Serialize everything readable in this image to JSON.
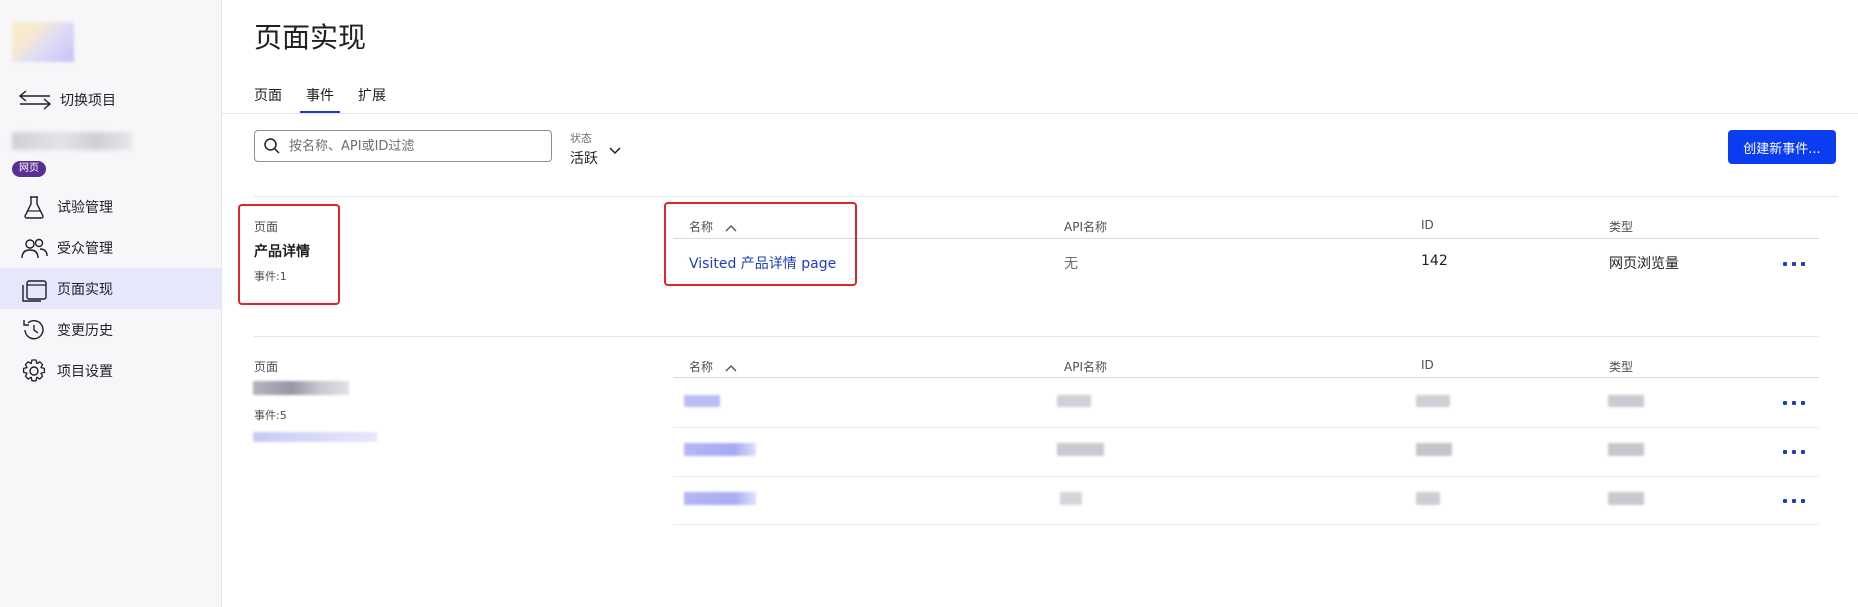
{
  "sidebar": {
    "switch_project": "切换项目",
    "badge": "网页",
    "items": [
      {
        "label": "试验管理",
        "icon": "flask-icon"
      },
      {
        "label": "受众管理",
        "icon": "audience-icon"
      },
      {
        "label": "页面实现",
        "icon": "pages-icon",
        "active": true
      },
      {
        "label": "变更历史",
        "icon": "history-icon"
      },
      {
        "label": "项目设置",
        "icon": "gear-icon"
      }
    ]
  },
  "header": {
    "title": "页面实现",
    "tabs": [
      "页面",
      "事件",
      "扩展"
    ],
    "active_tab": "事件"
  },
  "toolbar": {
    "search_placeholder": "按名称、API或ID过滤",
    "status_label": "状态",
    "status_value": "活跃",
    "create_button": "创建新事件..."
  },
  "columns": {
    "name": "名称",
    "api_name": "API名称",
    "id": "ID",
    "type": "类型"
  },
  "groups": [
    {
      "page_label": "页面",
      "page_name": "产品详情",
      "event_count": "事件:1",
      "rows": [
        {
          "name": "Visited 产品详情 page",
          "api_name": "无",
          "id": "142",
          "type": "网页浏览量"
        }
      ]
    },
    {
      "page_label": "页面",
      "event_count": "事件:5",
      "rows": []
    }
  ],
  "colors": {
    "accent": "#1a3ec8",
    "button": "#0a3cf2",
    "badge": "#5b2e91",
    "highlight": "#e0262b",
    "active_nav": "#e5e8fb"
  }
}
